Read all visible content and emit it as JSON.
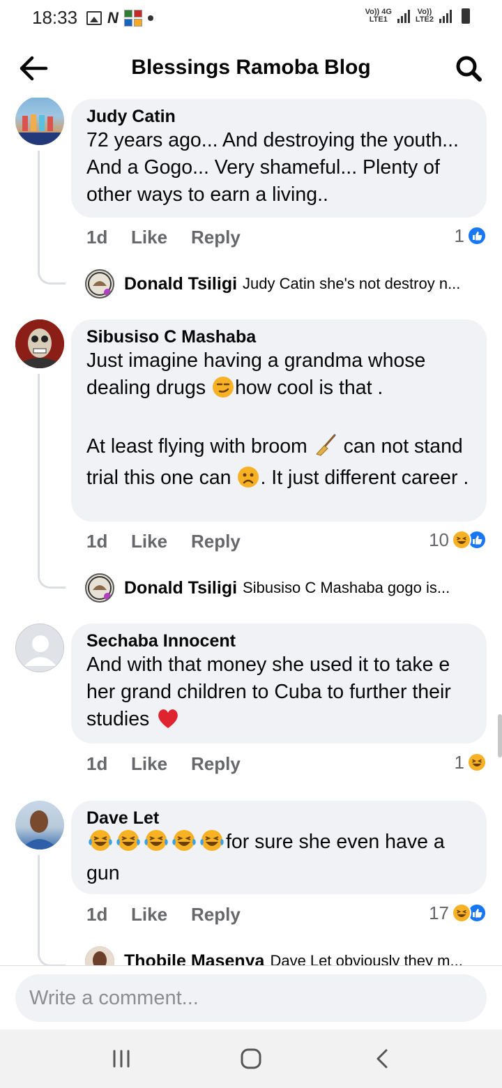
{
  "status_bar": {
    "time": "18:33",
    "sim1_top": "Vo)) 4G",
    "sim1_bottom": "LTE1",
    "sim2_top": "Vo))",
    "sim2_bottom": "LTE2"
  },
  "header": {
    "title": "Blessings Ramoba Blog"
  },
  "comments": [
    {
      "author": "Judy Catin",
      "text": "72 years ago... And destroying the youth... And a Gogo... Very shameful... Plenty of other ways to earn a living..",
      "time": "1d",
      "like_label": "Like",
      "reply_label": "Reply",
      "reaction_count": "1",
      "reactions": [
        "like"
      ],
      "replies": [
        {
          "author": "Donald Tsiligi",
          "text": "Judy Catin she's not destroy n..."
        }
      ]
    },
    {
      "author": "Sibusiso C Mashaba",
      "text_line1": "Just imagine having a grandma whose dealing drugs",
      "text_line1b": "how cool is that .",
      "text_line2a": "At least flying with broom",
      "text_line2b": "can not stand trial this one can",
      "text_line2c": ". It just different career .",
      "time": "1d",
      "like_label": "Like",
      "reply_label": "Reply",
      "reaction_count": "10",
      "reactions": [
        "haha",
        "like"
      ],
      "replies": [
        {
          "author": "Donald Tsiligi",
          "text": "Sibusiso C Mashaba gogo is..."
        }
      ]
    },
    {
      "author": "Sechaba Innocent",
      "text": "And with that money she used it to take e her grand children to Cuba to further their studies",
      "time": "1d",
      "like_label": "Like",
      "reply_label": "Reply",
      "reaction_count": "1",
      "reactions": [
        "haha"
      ]
    },
    {
      "author": "Dave Let",
      "text": "for sure she even have a gun",
      "time": "1d",
      "like_label": "Like",
      "reply_label": "Reply",
      "reaction_count": "17",
      "reactions": [
        "haha",
        "like"
      ],
      "replies": [
        {
          "author": "Thobile Masenya",
          "text": "Dave Let obviously they m..."
        }
      ]
    }
  ],
  "composer": {
    "placeholder": "Write a comment..."
  },
  "colors": {
    "bubble": "#f0f2f5",
    "like_blue": "#1877f2",
    "haha_yellow": "#f7b125",
    "meta_gray": "#65676b"
  },
  "icons": {
    "back": "arrow-left-icon",
    "search": "search-icon",
    "like": "thumbs-up-icon",
    "haha": "laughing-face-icon",
    "nav_recent": "recent-apps-icon",
    "nav_home": "home-icon",
    "nav_back": "chevron-left-icon"
  }
}
